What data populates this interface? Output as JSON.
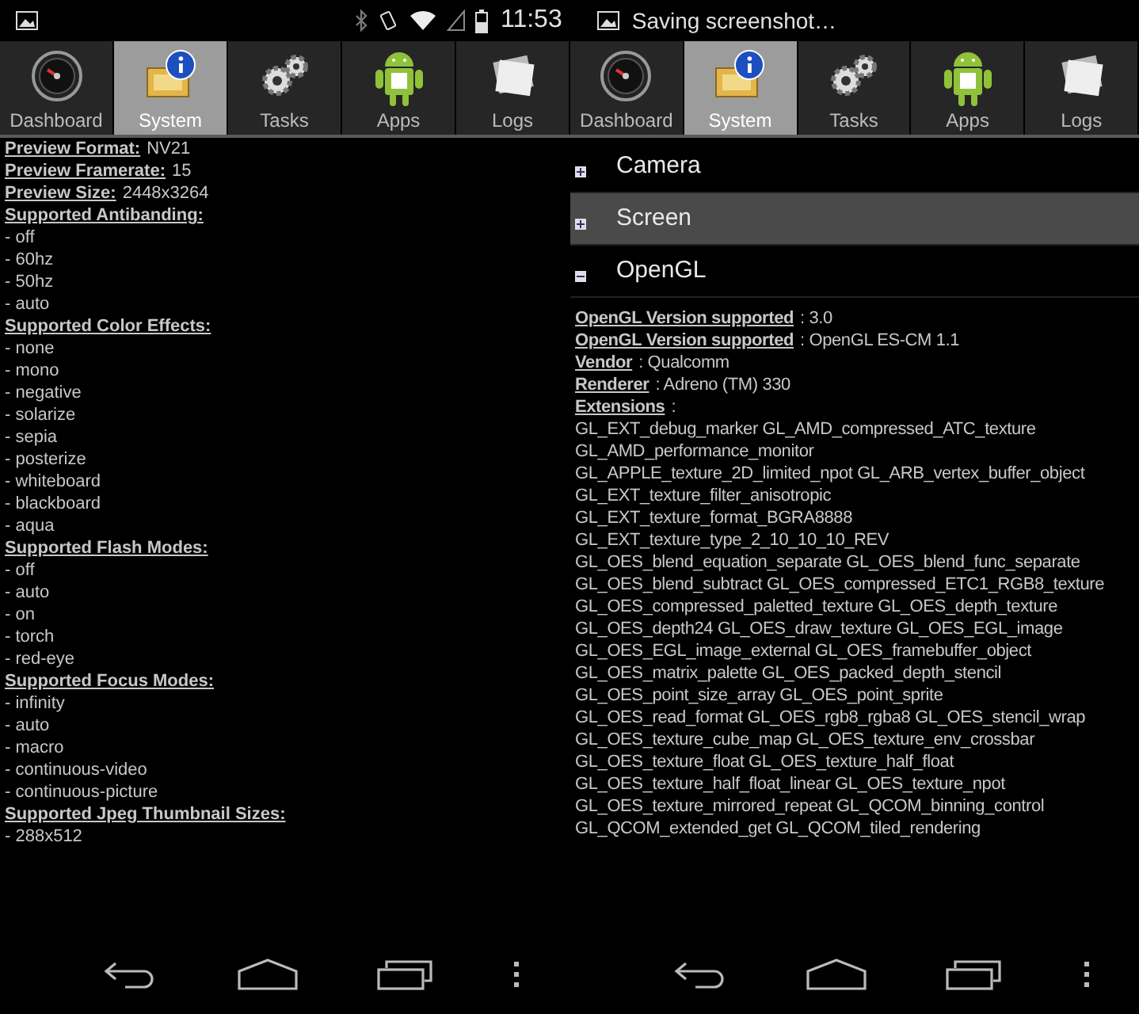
{
  "status_bar": {
    "time": "11:53",
    "ticker": "Saving screenshot…"
  },
  "panels": [
    {
      "tabs": [
        {
          "label": "Dashboard",
          "kind": "dashboard",
          "selected": false
        },
        {
          "label": "System",
          "kind": "system",
          "selected": true
        },
        {
          "label": "Tasks",
          "kind": "tasks",
          "selected": false
        },
        {
          "label": "Apps",
          "kind": "apps",
          "selected": false
        },
        {
          "label": "Logs",
          "kind": "logs",
          "selected": false
        }
      ],
      "lines": [
        {
          "kind": "field",
          "label": "Preview Format:",
          "value": "NV21"
        },
        {
          "kind": "field",
          "label": "Preview Framerate:",
          "value": "15"
        },
        {
          "kind": "field",
          "label": "Preview Size:",
          "value": "2448x3264"
        },
        {
          "kind": "heading",
          "label": "Supported Antibanding:"
        },
        {
          "kind": "item",
          "text": "- off"
        },
        {
          "kind": "item",
          "text": "- 60hz"
        },
        {
          "kind": "item",
          "text": "- 50hz"
        },
        {
          "kind": "item",
          "text": "- auto"
        },
        {
          "kind": "heading",
          "label": "Supported Color Effects:"
        },
        {
          "kind": "item",
          "text": "- none"
        },
        {
          "kind": "item",
          "text": "- mono"
        },
        {
          "kind": "item",
          "text": "- negative"
        },
        {
          "kind": "item",
          "text": "- solarize"
        },
        {
          "kind": "item",
          "text": "- sepia"
        },
        {
          "kind": "item",
          "text": "- posterize"
        },
        {
          "kind": "item",
          "text": "- whiteboard"
        },
        {
          "kind": "item",
          "text": "- blackboard"
        },
        {
          "kind": "item",
          "text": "- aqua"
        },
        {
          "kind": "heading",
          "label": "Supported Flash Modes:"
        },
        {
          "kind": "item",
          "text": "- off"
        },
        {
          "kind": "item",
          "text": "- auto"
        },
        {
          "kind": "item",
          "text": "- on"
        },
        {
          "kind": "item",
          "text": "- torch"
        },
        {
          "kind": "item",
          "text": "- red-eye"
        },
        {
          "kind": "heading",
          "label": "Supported Focus Modes:"
        },
        {
          "kind": "item",
          "text": "- infinity"
        },
        {
          "kind": "item",
          "text": "- auto"
        },
        {
          "kind": "item",
          "text": "- macro"
        },
        {
          "kind": "item",
          "text": "- continuous-video"
        },
        {
          "kind": "item",
          "text": "- continuous-picture"
        },
        {
          "kind": "heading",
          "label": "Supported Jpeg Thumbnail Sizes:"
        },
        {
          "kind": "item",
          "text": "- 288x512"
        }
      ]
    },
    {
      "tabs": [
        {
          "label": "Dashboard",
          "kind": "dashboard",
          "selected": false
        },
        {
          "label": "System",
          "kind": "system",
          "selected": true
        },
        {
          "label": "Tasks",
          "kind": "tasks",
          "selected": false
        },
        {
          "label": "Apps",
          "kind": "apps",
          "selected": false
        },
        {
          "label": "Logs",
          "kind": "logs",
          "selected": false
        }
      ],
      "sections": [
        {
          "title": "Camera",
          "expanded": false,
          "selected": false
        },
        {
          "title": "Screen",
          "expanded": false,
          "selected": true
        },
        {
          "title": "OpenGL",
          "expanded": true,
          "selected": false
        }
      ],
      "lines": [
        {
          "kind": "field",
          "label": "OpenGL Version supported",
          "value": ": 3.0"
        },
        {
          "kind": "field",
          "label": "OpenGL Version supported",
          "value": ": OpenGL ES-CM 1.1"
        },
        {
          "kind": "field",
          "label": "Vendor",
          "value": ": Qualcomm"
        },
        {
          "kind": "field",
          "label": "Renderer",
          "value": ": Adreno (TM) 330"
        },
        {
          "kind": "field",
          "label": "Extensions",
          "value": ":"
        },
        {
          "kind": "item",
          "text": "GL_EXT_debug_marker GL_AMD_compressed_ATC_texture"
        },
        {
          "kind": "item",
          "text": "GL_AMD_performance_monitor"
        },
        {
          "kind": "item",
          "text": "GL_APPLE_texture_2D_limited_npot GL_ARB_vertex_buffer_object"
        },
        {
          "kind": "item",
          "text": "GL_EXT_texture_filter_anisotropic"
        },
        {
          "kind": "item",
          "text": "GL_EXT_texture_format_BGRA8888"
        },
        {
          "kind": "item",
          "text": "GL_EXT_texture_type_2_10_10_10_REV"
        },
        {
          "kind": "item",
          "text": "GL_OES_blend_equation_separate GL_OES_blend_func_separate"
        },
        {
          "kind": "item",
          "text": "GL_OES_blend_subtract GL_OES_compressed_ETC1_RGB8_texture"
        },
        {
          "kind": "item",
          "text": "GL_OES_compressed_paletted_texture GL_OES_depth_texture"
        },
        {
          "kind": "item",
          "text": "GL_OES_depth24 GL_OES_draw_texture GL_OES_EGL_image"
        },
        {
          "kind": "item",
          "text": "GL_OES_EGL_image_external GL_OES_framebuffer_object"
        },
        {
          "kind": "item",
          "text": "GL_OES_matrix_palette GL_OES_packed_depth_stencil"
        },
        {
          "kind": "item",
          "text": "GL_OES_point_size_array GL_OES_point_sprite"
        },
        {
          "kind": "item",
          "text": "GL_OES_read_format GL_OES_rgb8_rgba8 GL_OES_stencil_wrap"
        },
        {
          "kind": "item",
          "text": "GL_OES_texture_cube_map GL_OES_texture_env_crossbar"
        },
        {
          "kind": "item",
          "text": "GL_OES_texture_float GL_OES_texture_half_float"
        },
        {
          "kind": "item",
          "text": "GL_OES_texture_half_float_linear GL_OES_texture_npot"
        },
        {
          "kind": "item",
          "text": "GL_OES_texture_mirrored_repeat GL_QCOM_binning_control"
        },
        {
          "kind": "item",
          "text": "GL_QCOM_extended_get GL_QCOM_tiled_rendering"
        }
      ]
    }
  ]
}
